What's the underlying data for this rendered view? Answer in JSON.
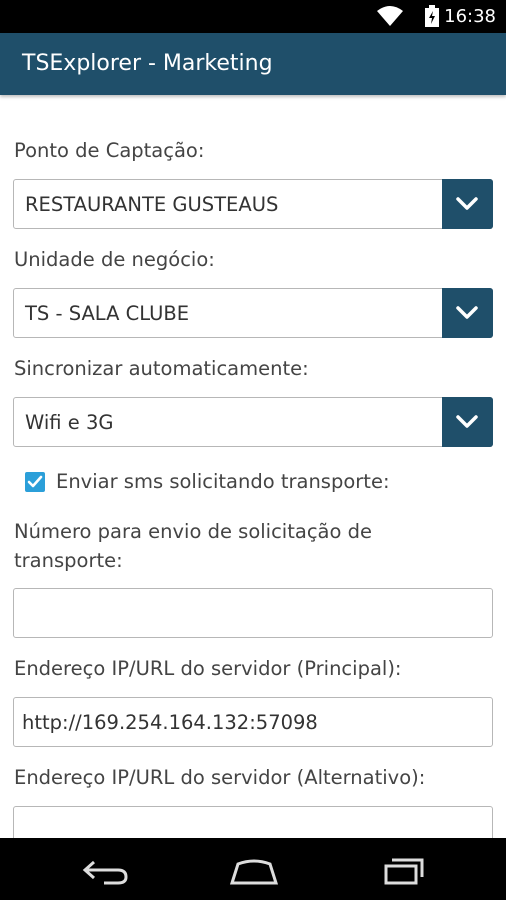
{
  "status_bar": {
    "time": "16:38"
  },
  "app_bar": {
    "title": "TSExplorer - Marketing"
  },
  "form": {
    "ponto_label": "Ponto de Captação:",
    "ponto_value": "RESTAURANTE GUSTEAUS",
    "unidade_label": "Unidade de negócio:",
    "unidade_value": "TS - SALA CLUBE",
    "sync_label": "Sincronizar automaticamente:",
    "sync_value": "Wifi e 3G",
    "sms_checkbox_label": "Enviar sms solicitando transporte:",
    "sms_checked": true,
    "numero_label_line1": "Número para envio de solicitação de",
    "numero_label_line2": "transporte:",
    "numero_value": "",
    "ip_principal_label": "Endereço IP/URL do servidor (Principal):",
    "ip_principal_value": "http://169.254.164.132:57098",
    "ip_alternativo_label": "Endereço IP/URL do servidor (Alternativo):",
    "ip_alternativo_value": ""
  },
  "nav_bar": {
    "icons": [
      "back-icon",
      "home-icon",
      "recent-apps-icon"
    ]
  },
  "colors": {
    "primary": "#1f4f6a",
    "checkbox": "#2b9fd9"
  }
}
